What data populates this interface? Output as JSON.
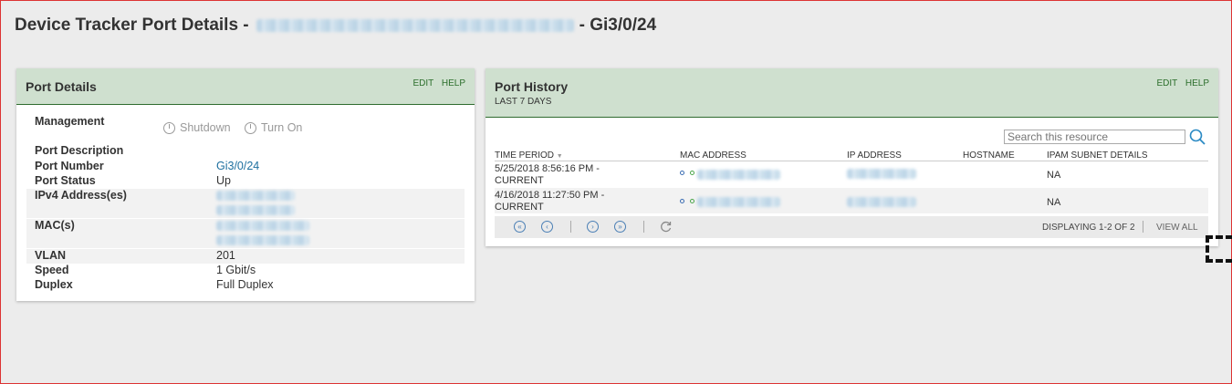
{
  "page": {
    "title_prefix": "Device Tracker Port Details -",
    "title_suffix": "- Gi3/0/24"
  },
  "port_details": {
    "title": "Port Details",
    "actions": {
      "edit": "EDIT",
      "help": "HELP"
    },
    "management_label": "Management",
    "shutdown_label": "Shutdown",
    "turn_on_label": "Turn On",
    "rows": {
      "description": {
        "label": "Port Description",
        "value": ""
      },
      "number": {
        "label": "Port Number",
        "value": "Gi3/0/24"
      },
      "status": {
        "label": "Port Status",
        "value": "Up"
      },
      "ipv4": {
        "label": "IPv4 Address(es)"
      },
      "mac": {
        "label": "MAC(s)"
      },
      "vlan": {
        "label": "VLAN",
        "value": "201"
      },
      "speed": {
        "label": "Speed",
        "value": "1 Gbit/s"
      },
      "duplex": {
        "label": "Duplex",
        "value": "Full Duplex"
      }
    }
  },
  "port_history": {
    "title": "Port History",
    "subtitle": "LAST 7 DAYS",
    "actions": {
      "edit": "EDIT",
      "help": "HELP"
    },
    "search_placeholder": "Search this resource",
    "columns": [
      "TIME PERIOD",
      "MAC ADDRESS",
      "IP ADDRESS",
      "HOSTNAME",
      "IPAM SUBNET DETAILS"
    ],
    "rows": [
      {
        "time_line1": "5/25/2018 8:56:16 PM -",
        "time_line2": "CURRENT",
        "ipam": "NA"
      },
      {
        "time_line1": "4/16/2018 11:27:50 PM -",
        "time_line2": "CURRENT",
        "ipam": "NA"
      }
    ],
    "pager": {
      "displaying": "DISPLAYING 1-2 OF 2",
      "view_all": "VIEW ALL"
    }
  },
  "colors": {
    "header_bg": "#cfe0cf",
    "header_border": "#2f6b2f",
    "link": "#1d6f9f",
    "action": "#2b6e2b"
  }
}
